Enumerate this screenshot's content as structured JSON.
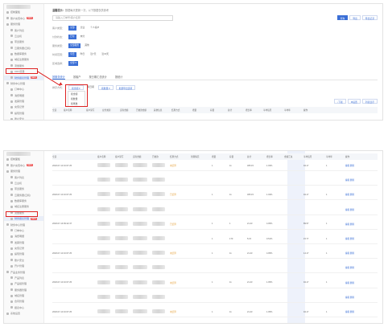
{
  "panel1": {
    "sidebar": [
      {
        "label": "控制面板",
        "type": "top"
      },
      {
        "label": "账户充值中心",
        "type": "top",
        "badge": "NEW"
      },
      {
        "label": "服务管理",
        "type": "top"
      },
      {
        "label": "客户列表",
        "type": "sub"
      },
      {
        "label": "云主机",
        "type": "sub"
      },
      {
        "label": "带宽服务",
        "type": "sub"
      },
      {
        "label": "云服务器(云机)",
        "type": "sub"
      },
      {
        "label": "数据库服务",
        "type": "sub"
      },
      {
        "label": "域名注册服务",
        "type": "sub"
      },
      {
        "label": "流量服务",
        "type": "sub"
      },
      {
        "label": "CDN流量",
        "type": "sub"
      },
      {
        "label": "财务报表管理",
        "type": "sub",
        "badge": "NEW",
        "active": true
      },
      {
        "label": "财务中心管理",
        "type": "top"
      },
      {
        "label": "订单中心",
        "type": "sub"
      },
      {
        "label": "消费明细",
        "type": "sub"
      },
      {
        "label": "发票管理",
        "type": "sub"
      },
      {
        "label": "充值记录",
        "type": "sub"
      },
      {
        "label": "提现管理",
        "type": "sub"
      },
      {
        "label": "账户安全",
        "type": "sub"
      },
      {
        "label": "开户管理",
        "type": "sub"
      }
    ],
    "tip": "温馨提示：",
    "tip_text": "数据每天更新一次，以下数据仅供参考",
    "search_placeholder": "请输入订单号/客户名称",
    "top_buttons": [
      "查询",
      "导出",
      "导出记录"
    ],
    "filters": [
      {
        "label": "客户类型：",
        "chips": [
          "全部",
          "企业",
          "个人客户"
        ],
        "on": 0
      },
      {
        "label": "付款状态：",
        "chips": [
          "已付",
          "未付"
        ],
        "on": 0
      },
      {
        "label": "服务类型：",
        "chips": [
          "全部服务",
          "其他"
        ],
        "on": 0
      },
      {
        "label": "时间范围：",
        "chips": [
          "今日",
          "昨日",
          "近7天",
          "近30天"
        ],
        "on": 0
      },
      {
        "label": "区域选择：",
        "chips": [
          "全部 ▾"
        ],
        "on": 0
      }
    ],
    "tabs": [
      "按服务统计",
      "按客户",
      "按日期汇总统计",
      "按统计"
    ],
    "sort_label": "排序方式：",
    "sort_value": "按金额 ▾",
    "sort_extra": [
      "按日期",
      "按数量 ▾",
      "批量导出选项"
    ],
    "dropdown": [
      "按金额",
      "按数量",
      "按笔数"
    ],
    "table_tools": [
      "↓下载",
      "⚙设置",
      "列表显示"
    ],
    "headers": [
      "全选",
      "客户名称",
      "客户简写",
      "业务类别",
      "实际金额",
      "已收款金额",
      "其他信息",
      "结算方式",
      "增量",
      "存量",
      "总计",
      "增长率",
      "平均每月",
      "平均年",
      "操作"
    ]
  },
  "panel2": {
    "sidebar": [
      {
        "label": "控制面板",
        "type": "top"
      },
      {
        "label": "账户充值中心",
        "type": "top",
        "badge": "NEW"
      },
      {
        "label": "服务管理",
        "type": "top"
      },
      {
        "label": "客户列表",
        "type": "sub"
      },
      {
        "label": "云主机",
        "type": "sub"
      },
      {
        "label": "带宽服务",
        "type": "sub"
      },
      {
        "label": "云服务器(云机)",
        "type": "sub"
      },
      {
        "label": "数据库服务",
        "type": "sub"
      },
      {
        "label": "域名注册服务",
        "type": "sub"
      },
      {
        "label": "流量服务",
        "type": "sub"
      },
      {
        "label": "财务报表管理",
        "type": "sub",
        "badge": "NEW",
        "active": true
      },
      {
        "label": "财务中心管理",
        "type": "top"
      },
      {
        "label": "订单中心",
        "type": "sub"
      },
      {
        "label": "消费明细",
        "type": "sub"
      },
      {
        "label": "发票管理",
        "type": "sub"
      },
      {
        "label": "充值记录",
        "type": "sub"
      },
      {
        "label": "提现管理",
        "type": "sub"
      },
      {
        "label": "账户安全",
        "type": "sub"
      },
      {
        "label": "开户管理",
        "type": "sub"
      },
      {
        "label": "产品业务管理",
        "type": "top"
      },
      {
        "label": "产品列表",
        "type": "sub"
      },
      {
        "label": "产品组管理",
        "type": "sub"
      },
      {
        "label": "服务器管理",
        "type": "sub"
      },
      {
        "label": "域名管理",
        "type": "sub"
      },
      {
        "label": "合同管理",
        "type": "sub"
      },
      {
        "label": "报表中心",
        "type": "sub"
      },
      {
        "label": "系统设置",
        "type": "top"
      }
    ],
    "headers": [
      "全选",
      "客户名称",
      "客户简写",
      "实际金额",
      "已收款",
      "结算方式",
      "到期情况",
      "增量",
      "存量",
      "总计",
      "增长率",
      "金额汇总",
      "平均每月",
      "平均年",
      "操作"
    ],
    "rows": [
      {
        "date": "2018-07-13 16:07:25",
        "status": "未结算",
        "a": "1",
        "b": "11",
        "c": "305.15",
        "d": "1.03%",
        "e": "94.17",
        "f": "1"
      },
      {
        "date": "",
        "status": "",
        "a": "",
        "b": "",
        "c": "",
        "d": "",
        "e": "",
        "f": ""
      },
      {
        "date": "2018-07-13 16:07:25",
        "status": "已结算",
        "a": "1",
        "b": "11",
        "c": "305.15",
        "d": "1.03%",
        "e": "94.17",
        "f": "1"
      },
      {
        "date": "",
        "status": "",
        "a": "",
        "b": "",
        "c": "",
        "d": "",
        "e": "",
        "f": ""
      },
      {
        "date": "2018-07-19 09:22:47",
        "status": "已结算",
        "a": "1",
        "b": "1",
        "c": "21.43",
        "d": "4.05%",
        "e": "89.57",
        "f": "1"
      },
      {
        "date": "",
        "status": "",
        "a": "1",
        "b": "170",
        "c": "5.15",
        "d": "0.51%",
        "e": "15.77",
        "f": "1"
      },
      {
        "date": "2018-07-13 16:07:25",
        "status": "未结算",
        "a": "1",
        "b": "11",
        "c": "21.43",
        "d": "4.05%",
        "e": "14.17",
        "f": "1"
      },
      {
        "date": "",
        "status": "",
        "a": "",
        "b": "",
        "c": "",
        "d": "",
        "e": "",
        "f": ""
      },
      {
        "date": "2018-07-13 16:07:25",
        "status": "未结算",
        "a": "1",
        "b": "11",
        "c": "21.43",
        "d": "1.05%",
        "e": "94.17",
        "f": "1"
      },
      {
        "date": "",
        "status": "",
        "a": "",
        "b": "",
        "c": "",
        "d": "",
        "e": "",
        "f": ""
      },
      {
        "date": "2018-07-13 16:07:25",
        "status": "未结算",
        "a": "1",
        "b": "11",
        "c": "21.43",
        "d": "1.05%",
        "e": "94.17",
        "f": "1"
      }
    ],
    "op_links": [
      "编辑",
      "删除"
    ]
  }
}
